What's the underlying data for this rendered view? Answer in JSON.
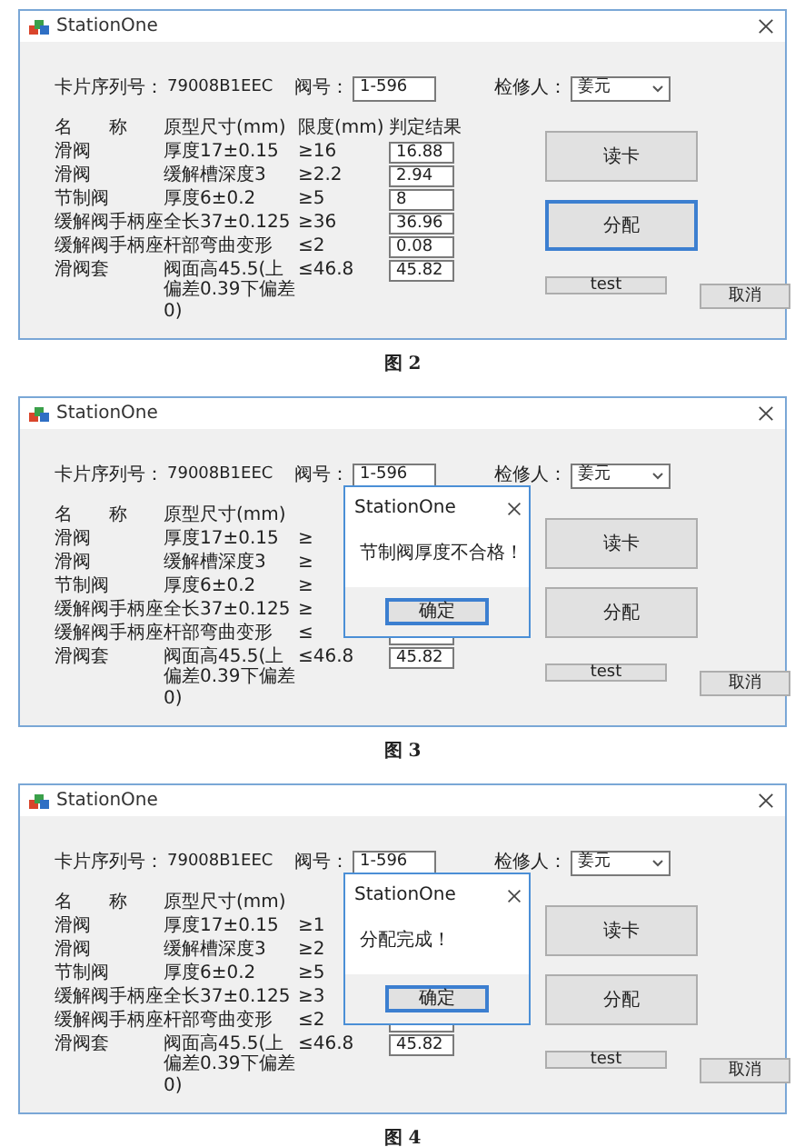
{
  "figures": [
    {
      "window": {
        "title": "StationOne"
      },
      "card_label": "卡片序列号：",
      "card_no": "79008B1EEC",
      "valve_label": "阀号：",
      "valve_no": "1-596",
      "inspector_label": "检修人：",
      "inspector": "姜元",
      "headers": [
        "名　　称",
        "原型尺寸(mm)",
        "限度(mm)",
        "判定结果"
      ],
      "rows": [
        {
          "name": "滑阀",
          "size": "厚度17±0.15",
          "limit": "≥16",
          "result": "16.88"
        },
        {
          "name": "滑阀",
          "size": "缓解槽深度3",
          "limit": "≥2.2",
          "result": "2.94"
        },
        {
          "name": "节制阀",
          "size": "厚度6±0.2",
          "limit": "≥5",
          "result": "8"
        },
        {
          "name": "缓解阀手柄座",
          "size": "全长37±0.125",
          "limit": "≥36",
          "result": "36.96"
        },
        {
          "name": "缓解阀手柄座",
          "size": "杆部弯曲变形",
          "limit": "≤2",
          "result": "0.08"
        },
        {
          "name": "滑阀套",
          "size": "阀面高45.5(上偏差0.39下偏差0)",
          "limit": "≤46.8",
          "result": "45.82"
        }
      ],
      "buttons": [
        {
          "label": "读卡",
          "focused": false
        },
        {
          "label": "分配",
          "focused": true
        }
      ],
      "test_button": "test",
      "cancel_button": "取消",
      "caption": "图 2"
    },
    {
      "window": {
        "title": "StationOne"
      },
      "card_label": "卡片序列号：",
      "card_no": "79008B1EEC",
      "valve_label": "阀号：",
      "valve_no": "1-596",
      "inspector_label": "检修人：",
      "inspector": "姜元",
      "headers": [
        "名　　称",
        "原型尺寸(mm)"
      ],
      "rows": [
        {
          "name": "滑阀",
          "size": "厚度17±0.15",
          "limit": "≥"
        },
        {
          "name": "滑阀",
          "size": "缓解槽深度3",
          "limit": "≥"
        },
        {
          "name": "节制阀",
          "size": "厚度6±0.2",
          "limit": "≥"
        },
        {
          "name": "缓解阀手柄座",
          "size": "全长37±0.125",
          "limit": "≥"
        },
        {
          "name": "缓解阀手柄座",
          "size": "杆部弯曲变形",
          "limit": "≤"
        },
        {
          "name": "滑阀套",
          "size": "阀面高45.5(上偏差0.39下偏差0)",
          "limit": "≤46.8",
          "result": "45.82"
        }
      ],
      "buttons": [
        {
          "label": "读卡",
          "focused": false
        },
        {
          "label": "分配",
          "focused": false
        }
      ],
      "test_button": "test",
      "cancel_button": "取消",
      "dialog": {
        "title": "StationOne",
        "message": "节制阀厚度不合格！",
        "ok": "确定"
      },
      "caption": "图 3"
    },
    {
      "window": {
        "title": "StationOne"
      },
      "card_label": "卡片序列号：",
      "card_no": "79008B1EEC",
      "valve_label": "阀号：",
      "valve_no": "1-596",
      "inspector_label": "检修人：",
      "inspector": "姜元",
      "headers": [
        "名　　称",
        "原型尺寸(mm)"
      ],
      "rows": [
        {
          "name": "滑阀",
          "size": "厚度17±0.15",
          "limit": "≥1"
        },
        {
          "name": "滑阀",
          "size": "缓解槽深度3",
          "limit": "≥2"
        },
        {
          "name": "节制阀",
          "size": "厚度6±0.2",
          "limit": "≥5"
        },
        {
          "name": "缓解阀手柄座",
          "size": "全长37±0.125",
          "limit": "≥3"
        },
        {
          "name": "缓解阀手柄座",
          "size": "杆部弯曲变形",
          "limit": "≤2"
        },
        {
          "name": "滑阀套",
          "size": "阀面高45.5(上偏差0.39下偏差0)",
          "limit": "≤46.8",
          "result": "45.82"
        }
      ],
      "buttons": [
        {
          "label": "读卡",
          "focused": false
        },
        {
          "label": "分配",
          "focused": false
        }
      ],
      "test_button": "test",
      "cancel_button": "取消",
      "dialog": {
        "title": "StationOne",
        "message": "分配完成！",
        "ok": "确定"
      },
      "caption": "图 4"
    }
  ]
}
